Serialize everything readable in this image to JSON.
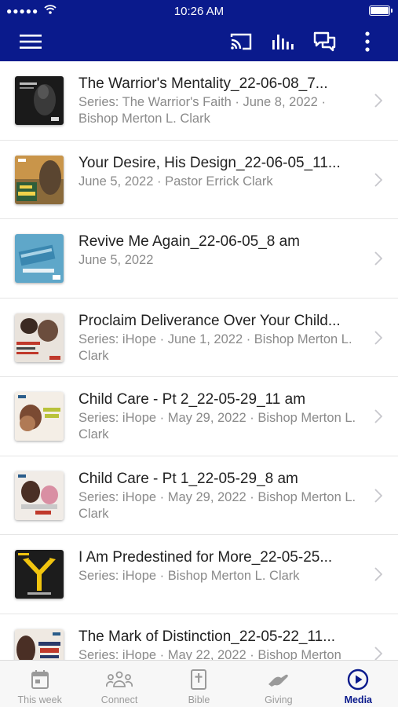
{
  "status": {
    "time": "10:26 AM",
    "signal": "●●●●●"
  },
  "colors": {
    "brand": "#0a1a8c",
    "tab_inactive": "#9a9a9a",
    "subtitle": "#8a8a8a"
  },
  "app_bar": {
    "icons": [
      "menu-icon",
      "cast-icon",
      "audio-bars-icon",
      "chat-icon",
      "more-vertical-icon"
    ]
  },
  "items": [
    {
      "title": "The Warrior's Mentality_22-06-08_7...",
      "subtitle": "Series: The Warrior's Faith · June 8, 2022 · Bishop Merton L. Clark"
    },
    {
      "title": "Your Desire, His Design_22-06-05_11...",
      "subtitle": "June 5, 2022 · Pastor Errick Clark"
    },
    {
      "title": "Revive Me Again_22-06-05_8 am",
      "subtitle": "June 5, 2022"
    },
    {
      "title": "Proclaim Deliverance Over Your Child...",
      "subtitle": "Series: iHope · June 1, 2022 · Bishop Merton L. Clark"
    },
    {
      "title": "Child Care - Pt 2_22-05-29_11 am",
      "subtitle": "Series: iHope · May 29, 2022 · Bishop Merton L. Clark"
    },
    {
      "title": "Child Care - Pt 1_22-05-29_8 am",
      "subtitle": "Series: iHope · May 29, 2022 · Bishop Merton L. Clark"
    },
    {
      "title": "I Am Predestined for More_22-05-25...",
      "subtitle": "Series: iHope · Bishop Merton L. Clark"
    },
    {
      "title": "The Mark of Distinction_22-05-22_11...",
      "subtitle": "Series: iHope · May 22, 2022 · Bishop Merton"
    }
  ],
  "tabs": [
    {
      "label": "This week",
      "icon": "calendar-icon",
      "active": false
    },
    {
      "label": "Connect",
      "icon": "people-icon",
      "active": false
    },
    {
      "label": "Bible",
      "icon": "bible-icon",
      "active": false
    },
    {
      "label": "Giving",
      "icon": "giving-hand-icon",
      "active": false
    },
    {
      "label": "Media",
      "icon": "play-circle-icon",
      "active": true
    }
  ]
}
